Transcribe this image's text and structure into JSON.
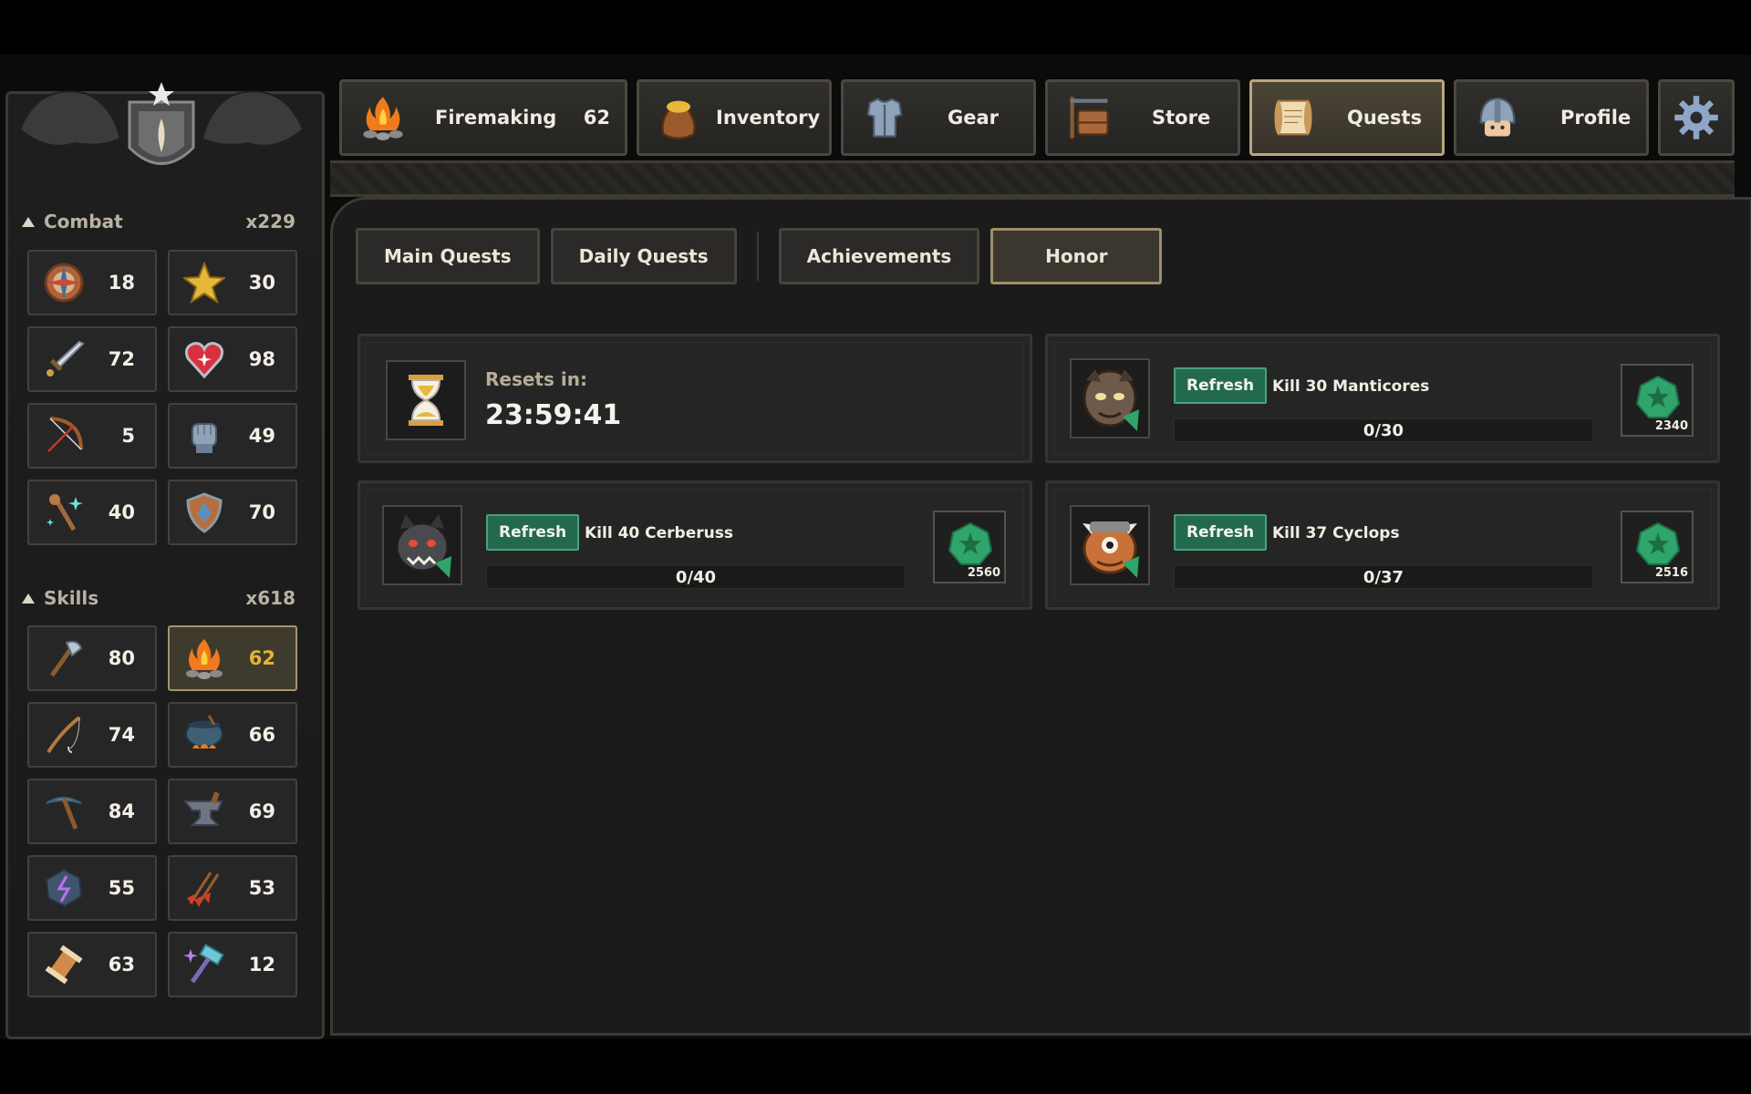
{
  "tabs": [
    {
      "label": "Firemaking",
      "level": "62",
      "icon": "campfire-icon",
      "active": false
    },
    {
      "label": "Inventory",
      "level": "",
      "icon": "sack-icon",
      "active": false
    },
    {
      "label": "Gear",
      "level": "",
      "icon": "armor-icon",
      "active": false
    },
    {
      "label": "Store",
      "level": "",
      "icon": "signpost-icon",
      "active": false
    },
    {
      "label": "Quests",
      "level": "",
      "icon": "scroll-icon",
      "active": true
    },
    {
      "label": "Profile",
      "level": "",
      "icon": "knight-helmet-icon",
      "active": false
    }
  ],
  "settings_icon": "gear-icon",
  "sidebar": {
    "combat": {
      "label": "Combat",
      "multiplier": "x229",
      "stats": [
        {
          "icon": "compass-icon",
          "value": "18"
        },
        {
          "icon": "star-icon",
          "value": "30"
        },
        {
          "icon": "sword-icon",
          "value": "72"
        },
        {
          "icon": "heart-icon",
          "value": "98"
        },
        {
          "icon": "bow-icon",
          "value": "5"
        },
        {
          "icon": "gauntlet-icon",
          "value": "49"
        },
        {
          "icon": "magic-staff-icon",
          "value": "40"
        },
        {
          "icon": "shield-icon",
          "value": "70"
        }
      ]
    },
    "skills": {
      "label": "Skills",
      "multiplier": "x618",
      "stats": [
        {
          "icon": "axe-icon",
          "value": "80",
          "active": false
        },
        {
          "icon": "campfire-icon",
          "value": "62",
          "active": true
        },
        {
          "icon": "fishing-rod-icon",
          "value": "74",
          "active": false
        },
        {
          "icon": "cauldron-icon",
          "value": "66",
          "active": false
        },
        {
          "icon": "pickaxe-icon",
          "value": "84",
          "active": false
        },
        {
          "icon": "anvil-icon",
          "value": "69",
          "active": false
        },
        {
          "icon": "rune-stone-icon",
          "value": "55",
          "active": false
        },
        {
          "icon": "arrows-icon",
          "value": "53",
          "active": false
        },
        {
          "icon": "thread-spool-icon",
          "value": "63",
          "active": false
        },
        {
          "icon": "enchant-hammer-icon",
          "value": "12",
          "active": false
        }
      ]
    }
  },
  "subtabs": [
    {
      "label": "Main Quests",
      "active": false
    },
    {
      "label": "Daily Quests",
      "active": false
    },
    {
      "label": "Achievements",
      "active": false
    },
    {
      "label": "Honor",
      "active": true
    }
  ],
  "reset": {
    "label": "Resets in:",
    "time": "23:59:41",
    "icon": "hourglass-icon"
  },
  "quests": [
    {
      "portrait": "manticore-portrait-icon",
      "refresh_label": "Refresh",
      "title": "Kill 30 Manticores",
      "progress_text": "0/30",
      "progress": 0.0,
      "reward": "2340",
      "reward_icon": "honor-star-icon"
    },
    {
      "portrait": "cerberus-portrait-icon",
      "refresh_label": "Refresh",
      "title": "Kill 40 Cerberuss",
      "progress_text": "0/40",
      "progress": 0.0,
      "reward": "2560",
      "reward_icon": "honor-star-icon"
    },
    {
      "portrait": "cyclops-portrait-icon",
      "refresh_label": "Refresh",
      "title": "Kill 37 Cyclops",
      "progress_text": "0/37",
      "progress": 0.0,
      "reward": "2516",
      "reward_icon": "honor-star-icon"
    }
  ],
  "colors": {
    "accent_gold": "#e2b634",
    "refresh_green": "#23694d",
    "honor_green": "#2fa46b"
  }
}
